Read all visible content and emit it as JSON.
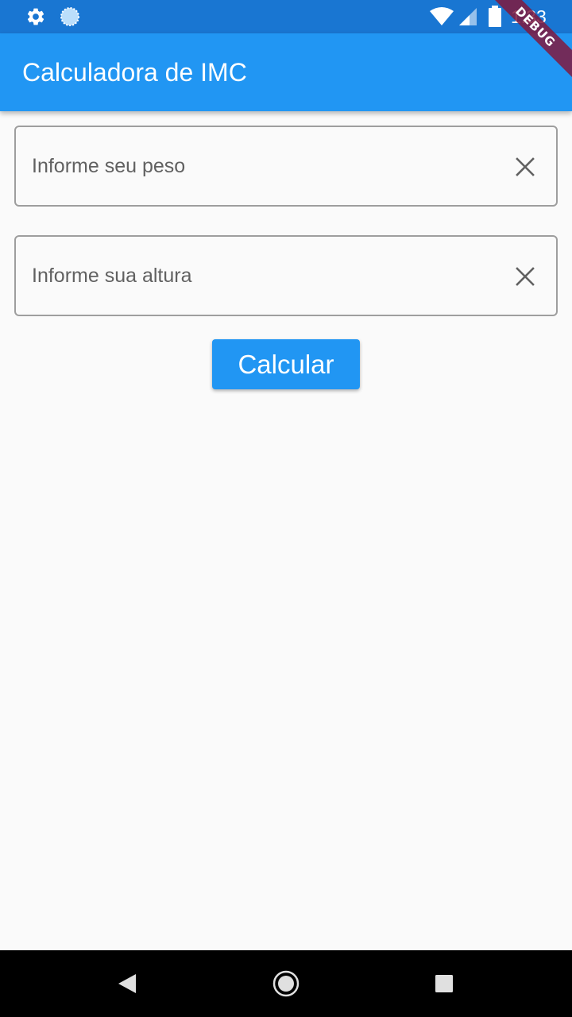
{
  "status_bar": {
    "time": "1:33",
    "icons": [
      "settings-icon",
      "sync-icon",
      "wifi-icon",
      "signal-icon",
      "battery-icon"
    ]
  },
  "app_bar": {
    "title": "Calculadora de IMC",
    "color": "#2196f3"
  },
  "debug_banner": {
    "label": "DEBUG"
  },
  "form": {
    "peso_field": {
      "placeholder": "Informe seu peso",
      "value": ""
    },
    "altura_field": {
      "placeholder": "Informe sua altura",
      "value": ""
    },
    "calcular_button_label": "Calcular"
  },
  "navigation_bar": {
    "icons": [
      "back-icon",
      "home-icon",
      "recents-icon"
    ]
  },
  "colors": {
    "primary": "#2196f3",
    "status_bar": "#1976d2",
    "background": "#fafafa",
    "debug_ribbon": "#801a3e"
  }
}
